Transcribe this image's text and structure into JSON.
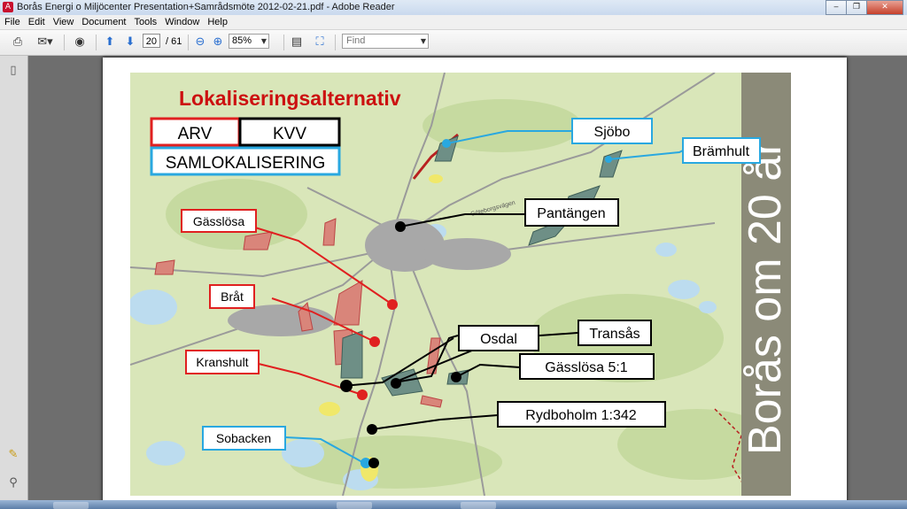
{
  "window": {
    "title": "Borås Energi o Miljöcenter Presentation+Samrådsmöte 2012-02-21.pdf - Adobe Reader",
    "controls": [
      "‒",
      "❐",
      "✕"
    ]
  },
  "menu": [
    "File",
    "Edit",
    "View",
    "Document",
    "Tools",
    "Window",
    "Help"
  ],
  "toolbar": {
    "page_current": "20",
    "page_total": "/ 61",
    "zoom": "85%",
    "find_placeholder": "Find"
  },
  "slide": {
    "title": "Lokaliseringsalternativ",
    "legend": {
      "arv": "ARV",
      "kvv": "KVV",
      "samlokalisering": "SAMLOKALISERING"
    },
    "side_text": "Borås om 20 år",
    "labels": {
      "sjobo": "Sjöbo",
      "bramhult": "Brämhult",
      "pantangen": "Pantängen",
      "gasslosa": "Gässlösa",
      "brat": "Bråt",
      "osdal": "Osdal",
      "transas": "Transås",
      "kranshult": "Kranshult",
      "gasslosa51": "Gässlösa 5:1",
      "rydboholm": "Rydboholm 1:342",
      "sobacken": "Sobacken",
      "map_text": "Göteborgsvägen"
    }
  },
  "colors": {
    "arv_red": "#e02020",
    "kvv_black": "#000000",
    "saml_blue": "#29a8e0",
    "title_red": "#cc1010",
    "map_green": "#d8e6b8",
    "water": "#bcdcef"
  }
}
